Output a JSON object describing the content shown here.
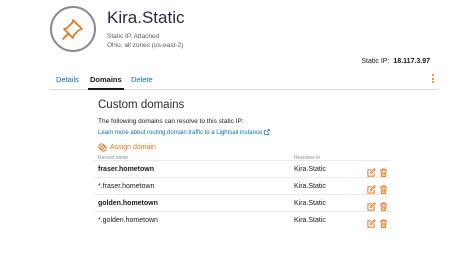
{
  "header": {
    "title": "Kira.Static",
    "status": "Static IP, Attached",
    "location": "Ohio, all zones (us-east-2)",
    "icon": "pushpin-icon"
  },
  "static_ip": {
    "label": "Static IP:",
    "value": "18.117.3.97"
  },
  "tabs": [
    {
      "label": "Details",
      "active": false
    },
    {
      "label": "Domains",
      "active": true
    },
    {
      "label": "Delete",
      "active": false
    }
  ],
  "domains": {
    "title": "Custom domains",
    "description": "The following domains can resolve to this static IP:",
    "learn_link": "Learn more about routing domain traffic to a Lightsail instance",
    "assign_label": "Assign domain",
    "columns": {
      "record_name": "Record name",
      "resolves_to": "Resolves to"
    },
    "rows": [
      {
        "name": "fraser.hometown",
        "target": "Kira.Static",
        "bold": true
      },
      {
        "name": "*.fraser.hometown",
        "target": "Kira.Static",
        "bold": false
      },
      {
        "name": "golden.hometown",
        "target": "Kira.Static",
        "bold": true
      },
      {
        "name": "*.golden.hometown",
        "target": "Kira.Static",
        "bold": false
      }
    ]
  },
  "colors": {
    "accent_orange": "#ec7211",
    "link_blue": "#0073bb",
    "icon_gray": "#8a8a8a"
  }
}
